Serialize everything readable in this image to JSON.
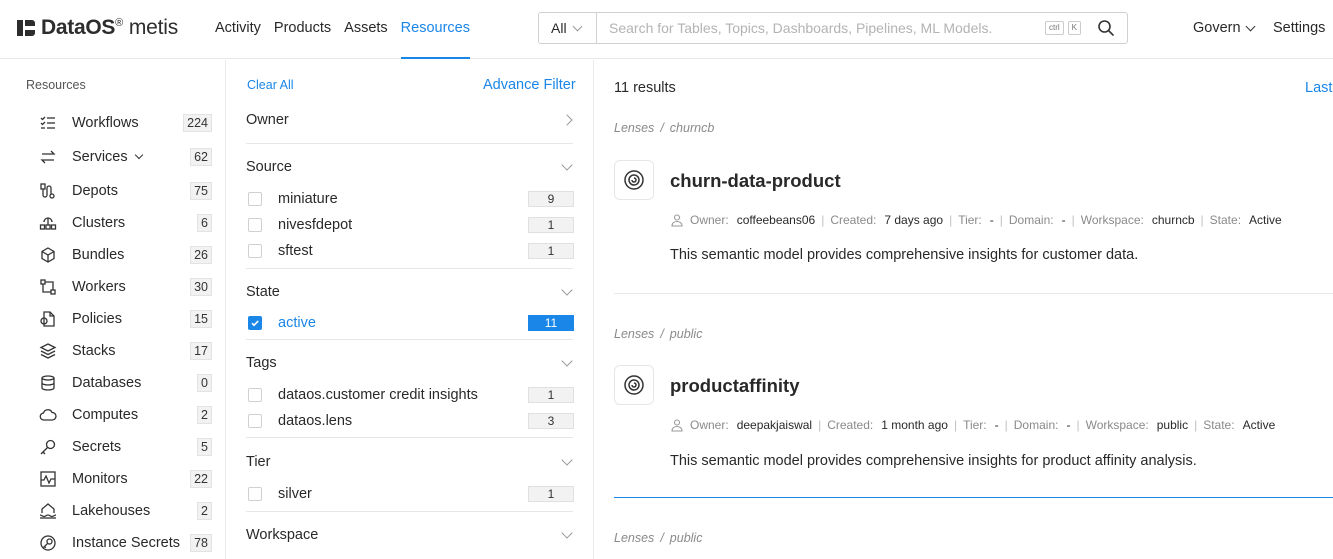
{
  "brand": {
    "name": "DataOS",
    "reg": "®",
    "product": "metis"
  },
  "nav": [
    "Activity",
    "Products",
    "Assets",
    "Resources"
  ],
  "nav_active": "Resources",
  "search": {
    "scope": "All",
    "placeholder": "Search for Tables, Topics, Dashboards, Pipelines, ML Models.",
    "kbd1": "ctrl",
    "kbd2": "K"
  },
  "govern": "Govern",
  "settings": "Settings",
  "sidebar": {
    "title": "Resources",
    "items": [
      {
        "label": "Workflows",
        "count": "224",
        "icon": "workflow-icon"
      },
      {
        "label": "Services",
        "count": "62",
        "icon": "services-icon"
      },
      {
        "label": "Depots",
        "count": "75",
        "icon": "depot-icon"
      },
      {
        "label": "Clusters",
        "count": "6",
        "icon": "cluster-icon"
      },
      {
        "label": "Bundles",
        "count": "26",
        "icon": "bundle-icon"
      },
      {
        "label": "Workers",
        "count": "30",
        "icon": "worker-icon"
      },
      {
        "label": "Policies",
        "count": "15",
        "icon": "policy-icon"
      },
      {
        "label": "Stacks",
        "count": "17",
        "icon": "stack-icon"
      },
      {
        "label": "Databases",
        "count": "0",
        "icon": "database-icon"
      },
      {
        "label": "Computes",
        "count": "2",
        "icon": "compute-icon"
      },
      {
        "label": "Secrets",
        "count": "5",
        "icon": "secret-icon"
      },
      {
        "label": "Monitors",
        "count": "22",
        "icon": "monitor-icon"
      },
      {
        "label": "Lakehouses",
        "count": "2",
        "icon": "lakehouse-icon"
      },
      {
        "label": "Instance Secrets",
        "count": "78",
        "icon": "instance-secret-icon"
      }
    ]
  },
  "filters": {
    "clear_all": "Clear All",
    "advance_filter": "Advance Filter",
    "owner": "Owner",
    "source": {
      "title": "Source",
      "options": [
        {
          "label": "miniature",
          "count": "9"
        },
        {
          "label": "nivesfdepot",
          "count": "1"
        },
        {
          "label": "sftest",
          "count": "1"
        }
      ]
    },
    "state": {
      "title": "State",
      "options": [
        {
          "label": "active",
          "count": "11",
          "checked": true
        }
      ]
    },
    "tags": {
      "title": "Tags",
      "options": [
        {
          "label": "dataos.customer credit insights",
          "count": "1"
        },
        {
          "label": "dataos.lens",
          "count": "3"
        }
      ]
    },
    "tier": {
      "title": "Tier",
      "options": [
        {
          "label": "silver",
          "count": "1"
        }
      ]
    },
    "workspace": {
      "title": "Workspace"
    }
  },
  "results": {
    "count": "11 results",
    "last": "Last",
    "items": [
      {
        "crumb_a": "Lenses",
        "crumb_b": "churncb",
        "title": "churn-data-product",
        "owner": "coffeebeans06",
        "created": "7 days ago",
        "tier": "-",
        "domain": "-",
        "workspace": "churncb",
        "state": "Active",
        "desc": "This semantic model provides comprehensive insights for customer data."
      },
      {
        "crumb_a": "Lenses",
        "crumb_b": "public",
        "title": "productaffinity",
        "owner": "deepakjaiswal",
        "created": "1 month ago",
        "tier": "-",
        "domain": "-",
        "workspace": "public",
        "state": "Active",
        "desc": "This semantic model provides comprehensive insights for product affinity analysis."
      },
      {
        "crumb_a": "Lenses",
        "crumb_b": "public"
      }
    ],
    "labels": {
      "owner": "Owner:",
      "created": "Created:",
      "tier": "Tier:",
      "domain": "Domain:",
      "workspace": "Workspace:",
      "state": "State:"
    }
  },
  "colors": {
    "accent": "#1a86e8",
    "text": "#292929",
    "muted": "#8a8a8a"
  }
}
